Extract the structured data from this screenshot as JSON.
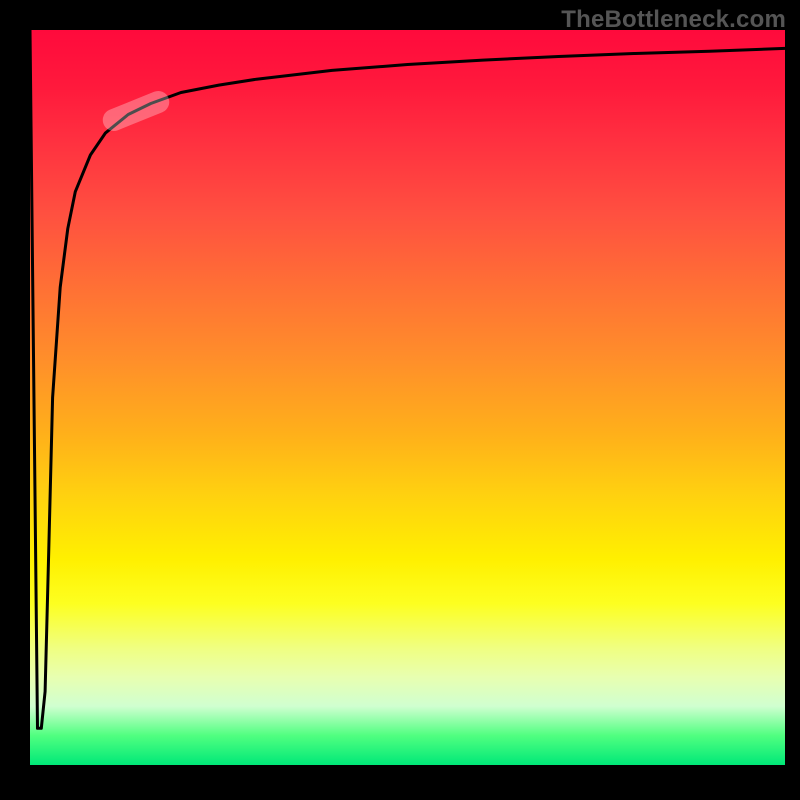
{
  "watermark": "TheBottleneck.com",
  "colors": {
    "frame": "#000000",
    "curve": "#000000",
    "highlight": "rgba(255,255,255,0.30)",
    "gradient_top": "#ff0a3c",
    "gradient_bottom": "#00e878"
  },
  "chart_data": {
    "type": "line",
    "title": "",
    "xlabel": "",
    "ylabel": "",
    "xlim": [
      0,
      100
    ],
    "ylim": [
      0,
      100
    ],
    "grid": false,
    "legend": false,
    "background_meaning": "vertical gradient red→yellow→green (top≈100 bad, bottom≈0 good)",
    "series": [
      {
        "name": "curve",
        "x": [
          0,
          1,
          1.5,
          2,
          2.5,
          3,
          4,
          5,
          6,
          8,
          10,
          13,
          16,
          20,
          25,
          30,
          40,
          50,
          60,
          70,
          80,
          90,
          100
        ],
        "y": [
          100,
          5,
          5,
          10,
          30,
          50,
          65,
          73,
          78,
          83,
          86,
          88.5,
          90,
          91.5,
          92.5,
          93.3,
          94.5,
          95.3,
          95.9,
          96.4,
          96.8,
          97.1,
          97.5
        ]
      }
    ],
    "highlight_segment": {
      "x": 14,
      "y": 89,
      "angle_deg": -22
    }
  }
}
